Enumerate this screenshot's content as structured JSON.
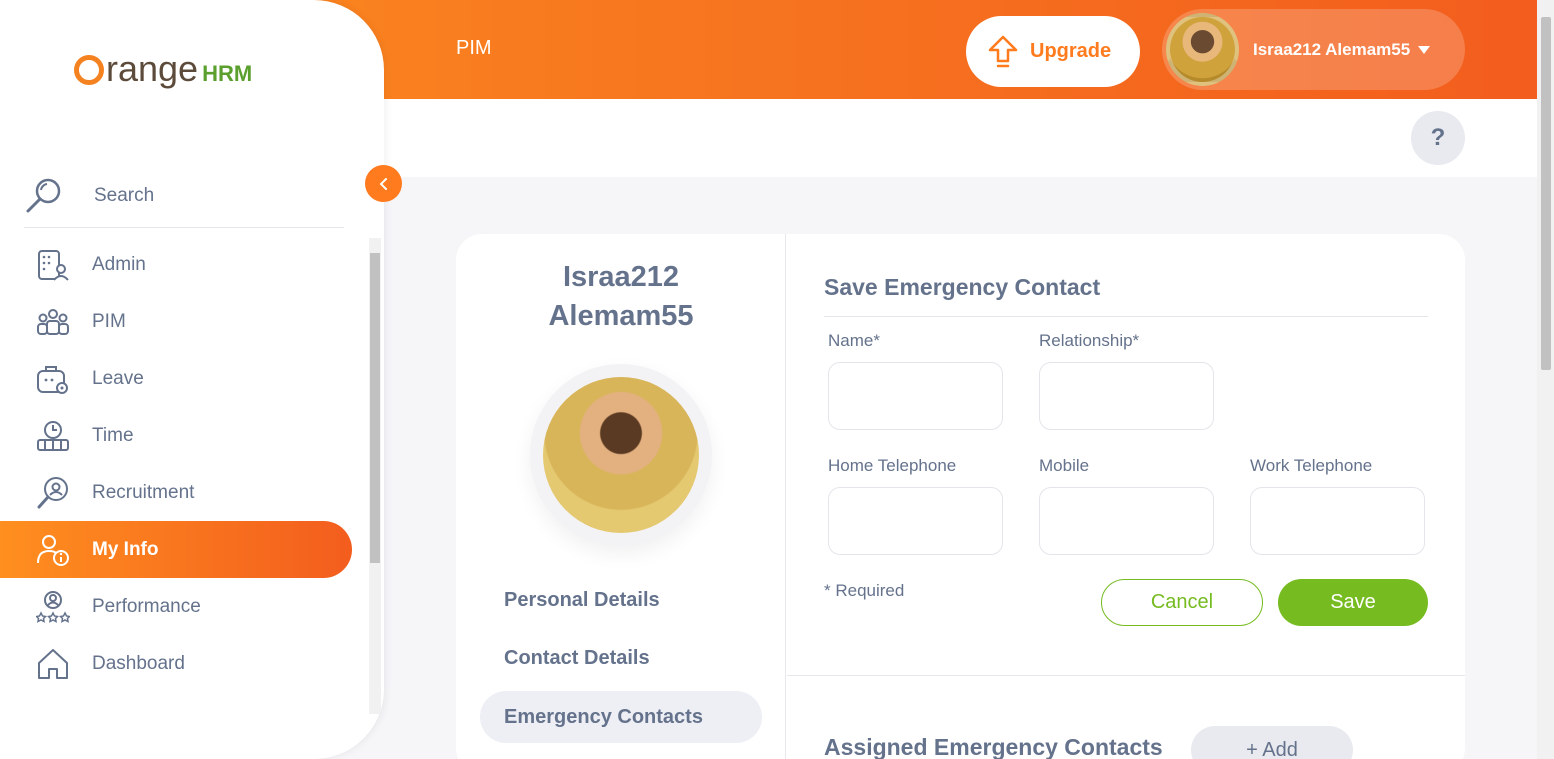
{
  "header": {
    "module_title": "PIM",
    "upgrade_label": "Upgrade",
    "user_name": "Israa212 Alemam55",
    "help_label": "?"
  },
  "sidebar": {
    "search_label": "Search",
    "items": [
      {
        "label": "Admin",
        "icon": "admin-icon"
      },
      {
        "label": "PIM",
        "icon": "pim-icon"
      },
      {
        "label": "Leave",
        "icon": "leave-icon"
      },
      {
        "label": "Time",
        "icon": "time-icon"
      },
      {
        "label": "Recruitment",
        "icon": "recruitment-icon"
      },
      {
        "label": "My Info",
        "icon": "my-info-icon",
        "active": true
      },
      {
        "label": "Performance",
        "icon": "performance-icon"
      },
      {
        "label": "Dashboard",
        "icon": "dashboard-icon"
      }
    ]
  },
  "employee": {
    "name_line1": "Israa212",
    "name_line2": "Alemam55"
  },
  "tabs": [
    {
      "label": "Personal Details"
    },
    {
      "label": "Contact Details"
    },
    {
      "label": "Emergency Contacts",
      "active": true
    }
  ],
  "form": {
    "title": "Save Emergency Contact",
    "name_label": "Name*",
    "relationship_label": "Relationship*",
    "home_phone_label": "Home Telephone",
    "mobile_label": "Mobile",
    "work_phone_label": "Work Telephone",
    "name_value": "",
    "relationship_value": "",
    "home_phone_value": "",
    "mobile_value": "",
    "work_phone_value": "",
    "required_note": "* Required",
    "cancel_label": "Cancel",
    "save_label": "Save"
  },
  "assigned": {
    "title": "Assigned Emergency Contacts",
    "add_label": "+ Add"
  },
  "colors": {
    "brand_orange": "#ff7b1d",
    "save_green": "#76bc21",
    "text_gray": "#64728c"
  }
}
